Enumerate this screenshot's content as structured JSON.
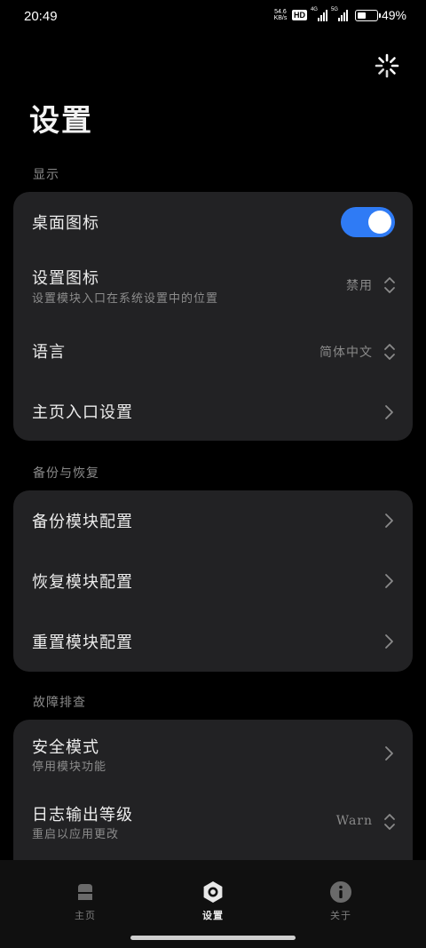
{
  "status_bar": {
    "time": "20:49",
    "net_speed_top": "54.6",
    "net_speed_bottom": "KB/s",
    "hd_badge": "HD",
    "sim1_label": "4G",
    "sim2_label": "5G",
    "battery_percent": "49%",
    "battery_level": 0.49
  },
  "page_title": "设置",
  "sections": {
    "display": {
      "header": "显示",
      "desktop_icon": {
        "title": "桌面图标",
        "enabled": true
      },
      "settings_icon": {
        "title": "设置图标",
        "subtitle": "设置模块入口在系统设置中的位置",
        "value": "禁用"
      },
      "language": {
        "title": "语言",
        "value": "简体中文"
      },
      "home_entry": {
        "title": "主页入口设置"
      }
    },
    "backup": {
      "header": "备份与恢复",
      "backup_config": {
        "title": "备份模块配置"
      },
      "restore_config": {
        "title": "恢复模块配置"
      },
      "reset_config": {
        "title": "重置模块配置"
      }
    },
    "troubleshoot": {
      "header": "故障排查",
      "safe_mode": {
        "title": "安全模式",
        "subtitle": "停用模块功能"
      },
      "log_level": {
        "title": "日志输出等级",
        "subtitle": "重启以应用更改",
        "value": "Warn"
      }
    }
  },
  "bottom_nav": {
    "home": {
      "label": "主页",
      "icon": "home-icon"
    },
    "settings": {
      "label": "设置",
      "icon": "settings-icon",
      "active": true
    },
    "about": {
      "label": "关于",
      "icon": "info-icon"
    }
  },
  "colors": {
    "accent": "#2f7bf5",
    "card_bg": "#222224",
    "background": "#000000"
  }
}
